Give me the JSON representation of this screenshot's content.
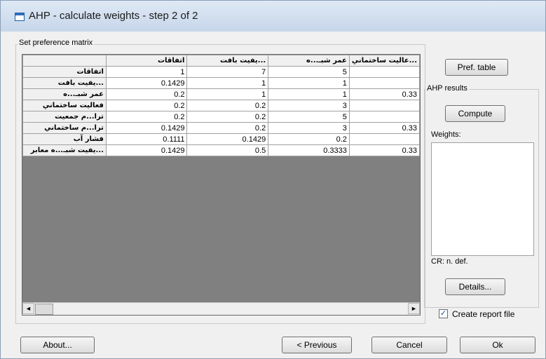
{
  "window": {
    "title": "AHP - calculate weights - step 2 of 2"
  },
  "matrix_group": {
    "label": "Set preference matrix"
  },
  "matrix": {
    "columns": [
      "اتفاقات",
      "...يفيت بافت",
      "عمر شبـ...ه",
      "...عاليت ساختماني"
    ],
    "rows": [
      {
        "label": "اتفاقات",
        "values": [
          "1",
          "7",
          "5",
          ""
        ]
      },
      {
        "label": "...يفيت بافت",
        "values": [
          "0.1429",
          "1",
          "1",
          ""
        ]
      },
      {
        "label": "عمر شبـ...ه",
        "values": [
          "0.2",
          "1",
          "1",
          "0.33"
        ]
      },
      {
        "label": "فعاليت ساختماني",
        "values": [
          "0.2",
          "0.2",
          "3",
          ""
        ]
      },
      {
        "label": "ترا...م جمعيت",
        "values": [
          "0.2",
          "0.2",
          "5",
          ""
        ]
      },
      {
        "label": "ترا...م ساختماني",
        "values": [
          "0.1429",
          "0.2",
          "3",
          "0.33"
        ]
      },
      {
        "label": "فشار آب",
        "values": [
          "0.1111",
          "0.1429",
          "0.2",
          ""
        ]
      },
      {
        "label": "...يفيت شبـ...ه معابر",
        "values": [
          "0.1429",
          "0.5",
          "0.3333",
          "0.33"
        ]
      }
    ],
    "scroll_left": "◄",
    "scroll_right": "►"
  },
  "buttons": {
    "pref_table": "Pref. table",
    "compute": "Compute",
    "details": "Details...",
    "about": "About...",
    "previous": "< Previous",
    "cancel": "Cancel",
    "ok": "Ok"
  },
  "ahp_results": {
    "label": "AHP results",
    "weights_label": "Weights:",
    "cr_label": "CR: n. def."
  },
  "report": {
    "label": "Create report file",
    "checked": true,
    "check_glyph": "✓"
  }
}
